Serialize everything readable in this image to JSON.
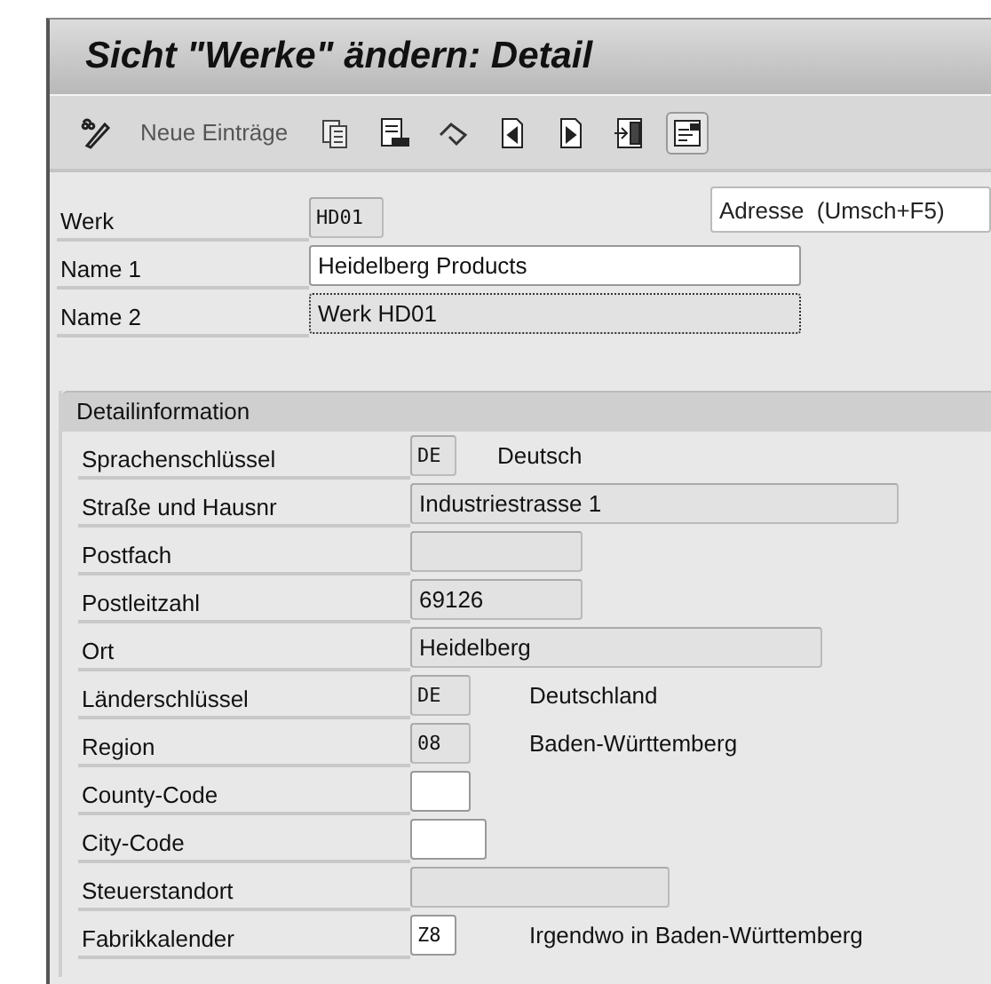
{
  "title": "Sicht \"Werke\" ändern: Detail",
  "toolbar": [
    {
      "kind": "display-change",
      "pressed": false
    },
    {
      "kind": "text",
      "label": "Neue Einträge"
    },
    {
      "kind": "copy",
      "pressed": false
    },
    {
      "kind": "delimit",
      "pressed": false
    },
    {
      "kind": "undo",
      "pressed": false
    },
    {
      "kind": "prev",
      "pressed": false
    },
    {
      "kind": "next",
      "pressed": false
    },
    {
      "kind": "select",
      "pressed": false
    },
    {
      "kind": "details",
      "pressed": true
    }
  ],
  "address_button": "Adresse  (Umsch+F5)",
  "header_fields": [
    {
      "label": "Werk",
      "value": "HD01",
      "kind": "code",
      "editable": false,
      "focused": false
    },
    {
      "label": "Name 1",
      "value": "Heidelberg Products",
      "kind": "text",
      "editable": true,
      "focused": false
    },
    {
      "label": "Name 2",
      "value": "Werk HD01",
      "kind": "text",
      "editable": false,
      "focused": true
    }
  ],
  "group": {
    "title": "Detailinformation",
    "rows": [
      {
        "label": "Sprachenschlüssel",
        "value": "DE",
        "kind": "code",
        "editable": false,
        "description": "Deutsch"
      },
      {
        "label": "Straße und Hausnr",
        "value": "Industriestrasse 1",
        "kind": "text",
        "editable": false
      },
      {
        "label": "Postfach",
        "kind": "text",
        "editable": false
      },
      {
        "label": "Postleitzahl",
        "value": "69126",
        "kind": "text",
        "editable": false
      },
      {
        "label": "Ort",
        "value": "Heidelberg",
        "kind": "text",
        "editable": false
      },
      {
        "label": "Länderschlüssel",
        "value": "DE",
        "kind": "code",
        "editable": false,
        "description": "Deutschland"
      },
      {
        "label": "Region",
        "value": "08",
        "kind": "code",
        "editable": false,
        "description": "Baden-Württemberg"
      },
      {
        "label": "County-Code",
        "kind": "text",
        "editable": true
      },
      {
        "label": "City-Code",
        "kind": "text",
        "editable": true
      },
      {
        "label": "Steuerstandort",
        "kind": "text",
        "editable": false
      },
      {
        "label": "Fabrikkalender",
        "value": "Z8",
        "kind": "code",
        "editable": true,
        "description": "Irgendwo in Baden-Württemberg"
      }
    ]
  }
}
